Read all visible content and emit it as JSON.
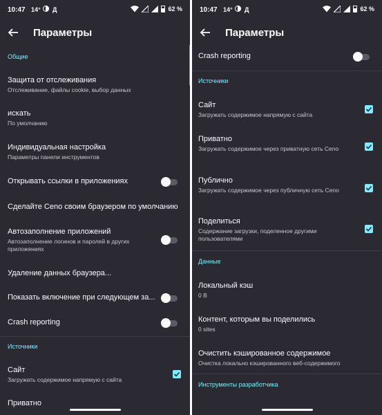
{
  "status_bar": {
    "time": "10:47",
    "temperature": "14°",
    "carrier": "Д",
    "battery": "62 %"
  },
  "left": {
    "title": "Параметры",
    "categories": {
      "general": "Общие",
      "sources": "Источники"
    },
    "items": [
      {
        "title": "Защита от отслеживания",
        "summary": "Отслеживание, файлы cookie, выбор данных"
      },
      {
        "title": "искать",
        "summary": "По умолчанию"
      },
      {
        "title": "Индивидуальная настройка",
        "summary": "Параметры панели инструментов"
      },
      {
        "title": "Открывать ссылки в приложениях",
        "toggle": false
      },
      {
        "title": "Сделайте Ceno своим браузером по умолчанию"
      },
      {
        "title": "Автозаполнение приложений",
        "summary": "Автозаполнение логинов и паролей в других приложениях",
        "toggle": false
      },
      {
        "title": "Удаление данных браузера..."
      },
      {
        "title": "Показать включение при следующем за...",
        "toggle": false
      },
      {
        "title": "Crash reporting",
        "toggle": false
      },
      {
        "title": "Сайт",
        "summary": "Загружать содержимое напрямую с сайта",
        "checked": true
      },
      {
        "title": "Приватно"
      }
    ]
  },
  "right": {
    "title": "Параметры",
    "categories": {
      "sources": "Источники",
      "data": "Данные",
      "developer": "Инструменты разработчика"
    },
    "items": [
      {
        "title": "Crash reporting",
        "toggle": false
      },
      {
        "title": "Сайт",
        "summary": "Загружать содержимое напрямую с сайта",
        "checked": true
      },
      {
        "title": "Приватно",
        "summary": "Загружать содержимое через приватную сеть Ceno",
        "checked": true
      },
      {
        "title": "Публично",
        "summary": "Загружать содержимое через публичную сеть Ceno",
        "checked": true
      },
      {
        "title": "Поделиться",
        "summary": "Содержание загрузки, поделенное другими пользователями",
        "checked": true
      },
      {
        "title": "Локальный кэш",
        "summary": "0 B"
      },
      {
        "title": "Контент, которым вы поделились",
        "summary": "0 sites"
      },
      {
        "title": "Очистить кэшированное содержимое",
        "summary": "Очистка локально кэшированного веб-содержимого"
      }
    ]
  },
  "colors": {
    "background": "#2b2a33",
    "accent": "#80ebff",
    "text": "#fbfbfe",
    "secondary": "#c8c8d0"
  }
}
